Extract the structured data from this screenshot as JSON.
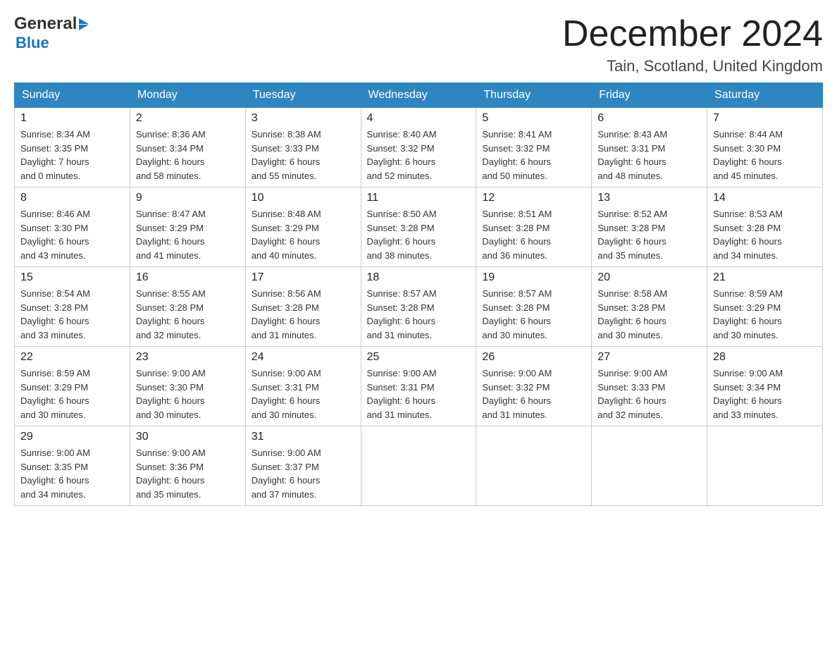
{
  "logo": {
    "general": "General",
    "arrow": "▶",
    "blue": "Blue"
  },
  "header": {
    "month": "December 2024",
    "location": "Tain, Scotland, United Kingdom"
  },
  "weekdays": [
    "Sunday",
    "Monday",
    "Tuesday",
    "Wednesday",
    "Thursday",
    "Friday",
    "Saturday"
  ],
  "weeks": [
    [
      {
        "day": "1",
        "sunrise": "8:34 AM",
        "sunset": "3:35 PM",
        "daylight_h": "7",
        "daylight_m": "0"
      },
      {
        "day": "2",
        "sunrise": "8:36 AM",
        "sunset": "3:34 PM",
        "daylight_h": "6",
        "daylight_m": "58"
      },
      {
        "day": "3",
        "sunrise": "8:38 AM",
        "sunset": "3:33 PM",
        "daylight_h": "6",
        "daylight_m": "55"
      },
      {
        "day": "4",
        "sunrise": "8:40 AM",
        "sunset": "3:32 PM",
        "daylight_h": "6",
        "daylight_m": "52"
      },
      {
        "day": "5",
        "sunrise": "8:41 AM",
        "sunset": "3:32 PM",
        "daylight_h": "6",
        "daylight_m": "50"
      },
      {
        "day": "6",
        "sunrise": "8:43 AM",
        "sunset": "3:31 PM",
        "daylight_h": "6",
        "daylight_m": "48"
      },
      {
        "day": "7",
        "sunrise": "8:44 AM",
        "sunset": "3:30 PM",
        "daylight_h": "6",
        "daylight_m": "45"
      }
    ],
    [
      {
        "day": "8",
        "sunrise": "8:46 AM",
        "sunset": "3:30 PM",
        "daylight_h": "6",
        "daylight_m": "43"
      },
      {
        "day": "9",
        "sunrise": "8:47 AM",
        "sunset": "3:29 PM",
        "daylight_h": "6",
        "daylight_m": "41"
      },
      {
        "day": "10",
        "sunrise": "8:48 AM",
        "sunset": "3:29 PM",
        "daylight_h": "6",
        "daylight_m": "40"
      },
      {
        "day": "11",
        "sunrise": "8:50 AM",
        "sunset": "3:28 PM",
        "daylight_h": "6",
        "daylight_m": "38"
      },
      {
        "day": "12",
        "sunrise": "8:51 AM",
        "sunset": "3:28 PM",
        "daylight_h": "6",
        "daylight_m": "36"
      },
      {
        "day": "13",
        "sunrise": "8:52 AM",
        "sunset": "3:28 PM",
        "daylight_h": "6",
        "daylight_m": "35"
      },
      {
        "day": "14",
        "sunrise": "8:53 AM",
        "sunset": "3:28 PM",
        "daylight_h": "6",
        "daylight_m": "34"
      }
    ],
    [
      {
        "day": "15",
        "sunrise": "8:54 AM",
        "sunset": "3:28 PM",
        "daylight_h": "6",
        "daylight_m": "33"
      },
      {
        "day": "16",
        "sunrise": "8:55 AM",
        "sunset": "3:28 PM",
        "daylight_h": "6",
        "daylight_m": "32"
      },
      {
        "day": "17",
        "sunrise": "8:56 AM",
        "sunset": "3:28 PM",
        "daylight_h": "6",
        "daylight_m": "31"
      },
      {
        "day": "18",
        "sunrise": "8:57 AM",
        "sunset": "3:28 PM",
        "daylight_h": "6",
        "daylight_m": "31"
      },
      {
        "day": "19",
        "sunrise": "8:57 AM",
        "sunset": "3:28 PM",
        "daylight_h": "6",
        "daylight_m": "30"
      },
      {
        "day": "20",
        "sunrise": "8:58 AM",
        "sunset": "3:28 PM",
        "daylight_h": "6",
        "daylight_m": "30"
      },
      {
        "day": "21",
        "sunrise": "8:59 AM",
        "sunset": "3:29 PM",
        "daylight_h": "6",
        "daylight_m": "30"
      }
    ],
    [
      {
        "day": "22",
        "sunrise": "8:59 AM",
        "sunset": "3:29 PM",
        "daylight_h": "6",
        "daylight_m": "30"
      },
      {
        "day": "23",
        "sunrise": "9:00 AM",
        "sunset": "3:30 PM",
        "daylight_h": "6",
        "daylight_m": "30"
      },
      {
        "day": "24",
        "sunrise": "9:00 AM",
        "sunset": "3:31 PM",
        "daylight_h": "6",
        "daylight_m": "30"
      },
      {
        "day": "25",
        "sunrise": "9:00 AM",
        "sunset": "3:31 PM",
        "daylight_h": "6",
        "daylight_m": "31"
      },
      {
        "day": "26",
        "sunrise": "9:00 AM",
        "sunset": "3:32 PM",
        "daylight_h": "6",
        "daylight_m": "31"
      },
      {
        "day": "27",
        "sunrise": "9:00 AM",
        "sunset": "3:33 PM",
        "daylight_h": "6",
        "daylight_m": "32"
      },
      {
        "day": "28",
        "sunrise": "9:00 AM",
        "sunset": "3:34 PM",
        "daylight_h": "6",
        "daylight_m": "33"
      }
    ],
    [
      {
        "day": "29",
        "sunrise": "9:00 AM",
        "sunset": "3:35 PM",
        "daylight_h": "6",
        "daylight_m": "34"
      },
      {
        "day": "30",
        "sunrise": "9:00 AM",
        "sunset": "3:36 PM",
        "daylight_h": "6",
        "daylight_m": "35"
      },
      {
        "day": "31",
        "sunrise": "9:00 AM",
        "sunset": "3:37 PM",
        "daylight_h": "6",
        "daylight_m": "37"
      },
      null,
      null,
      null,
      null
    ]
  ]
}
